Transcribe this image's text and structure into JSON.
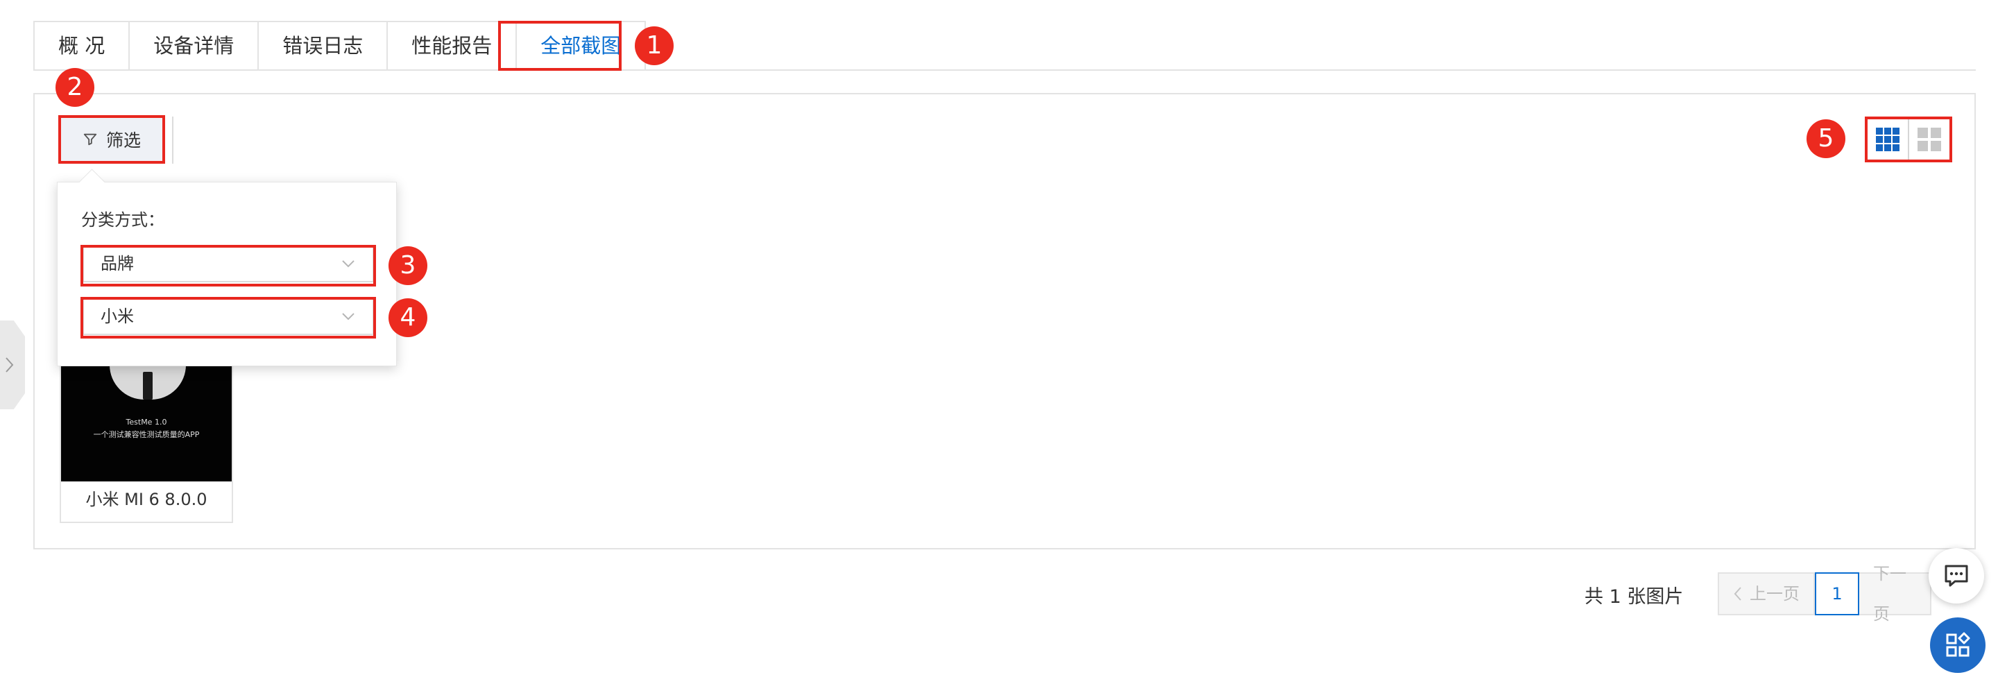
{
  "tabs": [
    {
      "label": "概 况"
    },
    {
      "label": "设备详情"
    },
    {
      "label": "错误日志"
    },
    {
      "label": "性能报告"
    },
    {
      "label": "全部截图"
    }
  ],
  "active_tab": "全部截图",
  "toolbar": {
    "filter_label": "筛选"
  },
  "filter_popover": {
    "title": "分类方式：",
    "category_select": "品牌",
    "value_select": "小米"
  },
  "screenshots": [
    {
      "caption": "小米 MI 6 8.0.0",
      "image_line1": "TestMe 1.0",
      "image_line2": "一个测试兼容性测试质量的APP"
    }
  ],
  "pagination": {
    "total_text": "共 1 张图片",
    "prev_label": "上一页",
    "current_page": "1",
    "next_label": "下一页"
  },
  "annotations": [
    "1",
    "2",
    "3",
    "4",
    "5"
  ],
  "colors": {
    "accent": "#0a6ed1",
    "annotation_red": "#e8271f",
    "fab_blue": "#1f6bc6"
  }
}
